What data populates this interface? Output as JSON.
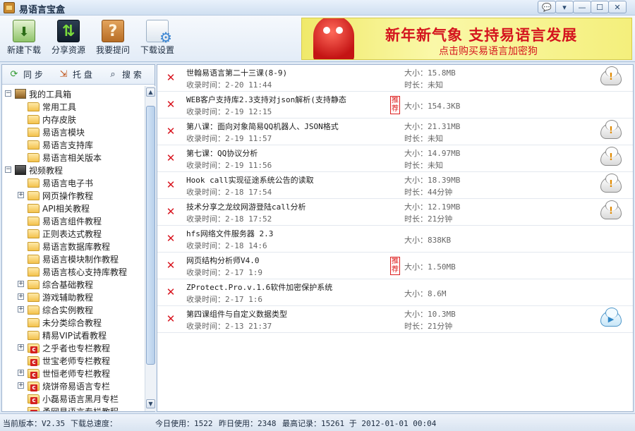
{
  "app": {
    "title": "易语言宝盒",
    "icon": "treasure-box-icon"
  },
  "window_buttons": [
    {
      "name": "feedback-button",
      "glyph": "💬"
    },
    {
      "name": "menu-button",
      "glyph": "▾"
    },
    {
      "name": "minimize-button",
      "glyph": "—"
    },
    {
      "name": "maximize-button",
      "glyph": "☐"
    },
    {
      "name": "close-button",
      "glyph": "✕"
    }
  ],
  "toolbar": {
    "new_download": "新建下载",
    "share": "分享资源",
    "ask": "我要提问",
    "settings": "下载设置"
  },
  "banner": {
    "main": "新年新气象 支持易语言发展",
    "sub": "点击购买易语言加密狗"
  },
  "left_tabs": {
    "sync": "同 步",
    "tray": "托 盘",
    "search": "搜 索"
  },
  "tree": {
    "toolbox": "我的工具箱",
    "toolbox_items": [
      "常用工具",
      "内存皮肤",
      "易语言模块",
      "易语言支持库",
      "易语言相关版本"
    ],
    "video": "视频教程",
    "video_items": [
      "易语言电子书",
      "网页操作教程",
      "API相关教程",
      "易语言组件教程",
      "正则表达式教程",
      "易语言数据库教程",
      "易语言模块制作教程",
      "易语言核心支持库教程",
      "综合基础教程",
      "游戏辅助教程",
      "综合实例教程",
      "未分类综合教程",
      "精易VIP试看教程",
      "之乎者也专栏教程",
      "世宝老师专栏教程",
      "世恒老师专栏教程",
      "烧饼帝易语言专栏",
      "小磊易语言黑月专栏",
      "甬网易语言专栏教程"
    ]
  },
  "downloads": [
    {
      "title": "世翰易语言第二十三课(8-9)",
      "time": "收录时间：2-20 11:44",
      "size": "大小：15.8MB",
      "duration": "时长：未知",
      "recommended": "",
      "action": "warning"
    },
    {
      "title": "WEB客户支持库2.3支持对json解析(支持静态",
      "time": "收录时间：2-19 12:15",
      "size": "大小：154.3KB",
      "duration": "",
      "recommended": "推荐",
      "action": ""
    },
    {
      "title": "第八课：面向对象简易QQ机器人、JSON格式",
      "time": "收录时间：2-19 11:57",
      "size": "大小：21.31MB",
      "duration": "时长：未知",
      "recommended": "",
      "action": "warning"
    },
    {
      "title": "第七课：QQ协议分析",
      "time": "收录时间：2-19 11:56",
      "size": "大小：14.97MB",
      "duration": "时长：未知",
      "recommended": "",
      "action": "warning"
    },
    {
      "title": "Hook call实现征途系统公告的读取",
      "time": "收录时间：2-18 17:54",
      "size": "大小：18.39MB",
      "duration": "时长：44分钟",
      "recommended": "",
      "action": "warning"
    },
    {
      "title": "技术分享之龙纹网游登陆call分析",
      "time": "收录时间：2-18 17:52",
      "size": "大小：12.19MB",
      "duration": "时长：21分钟",
      "recommended": "",
      "action": "warning"
    },
    {
      "title": "hfs网络文件服务器 2.3",
      "time": "收录时间：2-18 14:6",
      "size": "大小：838KB",
      "duration": "",
      "recommended": "",
      "action": ""
    },
    {
      "title": "网页结构分析师V4.0",
      "time": "收录时间：2-17 1:9",
      "size": "大小：1.50MB",
      "duration": "",
      "recommended": "推荐",
      "action": ""
    },
    {
      "title": "ZProtect.Pro.v.1.6软件加密保护系统",
      "time": "收录时间：2-17 1:6",
      "size": "大小：8.6M",
      "duration": "",
      "recommended": "",
      "action": ""
    },
    {
      "title": "第四课组件与自定义数据类型",
      "time": "收录时间：2-13 21:37",
      "size": "大小：10.3MB",
      "duration": "时长：21分钟",
      "recommended": "",
      "action": "play"
    }
  ],
  "status": {
    "version": "当前版本：V2.35",
    "speed": "下载总速度：",
    "today": "今日使用：1522",
    "yesterday": "昨日使用：2348",
    "record": "最高记录：15261 于 2012-01-01 00:04"
  },
  "colors": {
    "accent": "#d8141e",
    "banner_bg": "#f4ef7c",
    "tree_folder": "#f4c24d"
  }
}
